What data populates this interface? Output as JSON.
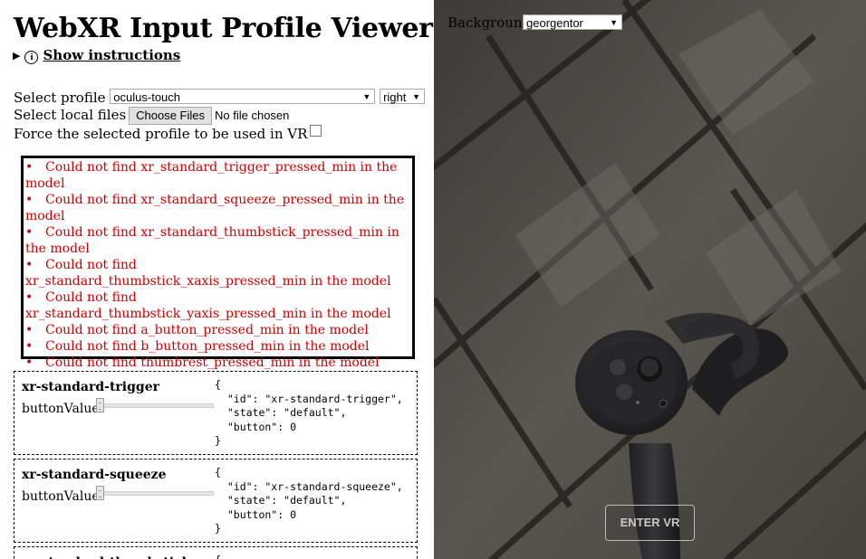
{
  "page": {
    "title": "WebXR Input Profile Viewer",
    "show_instructions": "Show instructions",
    "info_glyph": "i"
  },
  "controls": {
    "select_profile_label": "Select profile",
    "profile_value": "oculus-touch",
    "handedness_value": "right",
    "select_local_files_label": "Select local files",
    "choose_files_label": "Choose Files",
    "no_file_text": "No file chosen",
    "force_profile_label": "Force the selected profile to be used in VR",
    "force_profile_checked": false
  },
  "errors": [
    "Could not find xr_standard_trigger_pressed_min in the model",
    "Could not find xr_standard_squeeze_pressed_min in the model",
    "Could not find xr_standard_thumbstick_pressed_min in the model",
    "Could not find xr_standard_thumbstick_xaxis_pressed_min in the model",
    "Could not find xr_standard_thumbstick_yaxis_pressed_min in the model",
    "Could not find a_button_pressed_min in the model",
    "Could not find b_button_pressed_min in the model",
    "Could not find thumbrest_pressed_min in the model"
  ],
  "components": [
    {
      "name": "xr-standard-trigger",
      "button_label": "buttonValue",
      "button_value": 0,
      "json": "{\n  \"id\": \"xr-standard-trigger\",\n  \"state\": \"default\",\n  \"button\": 0\n}"
    },
    {
      "name": "xr-standard-squeeze",
      "button_label": "buttonValue",
      "button_value": 0,
      "json": "{\n  \"id\": \"xr-standard-squeeze\",\n  \"state\": \"default\",\n  \"button\": 0\n}"
    },
    {
      "name": "xr-standard-thumbstick",
      "json": "{"
    }
  ],
  "viewer": {
    "background_label": "Background",
    "background_value": "georgentor",
    "enter_vr_label": "ENTER VR"
  },
  "colors": {
    "error_text": "#cc0000",
    "floor_base": "#4a4741",
    "controller_body": "#2b2b2d"
  }
}
